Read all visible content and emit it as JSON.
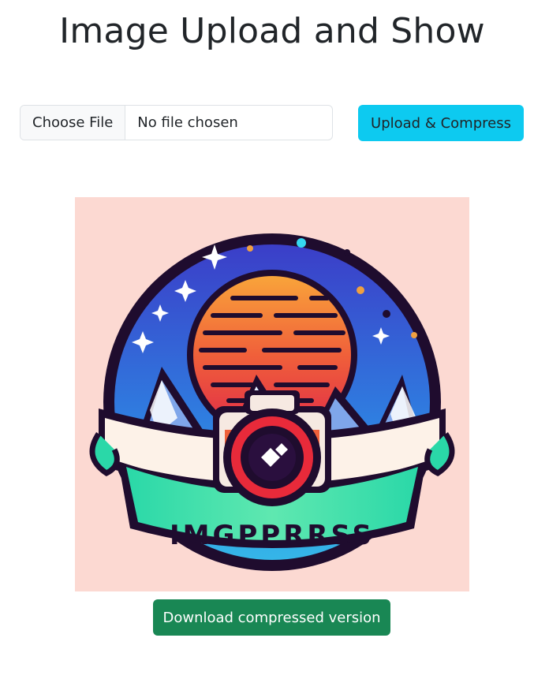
{
  "page": {
    "title": "Image Upload and Show"
  },
  "upload_form": {
    "choose_file_label": "Choose File",
    "file_status": "No file chosen",
    "upload_label": "Upload & Compress"
  },
  "preview": {
    "logo_text": "IMGPPRRSS"
  },
  "download": {
    "label": "Download compressed version"
  },
  "colors": {
    "upload_button": "#0dcaf0",
    "download_button": "#198754",
    "preview_background": "#fcd9d2"
  },
  "icons": {
    "logo": "camera-mountain-sunset-logo"
  }
}
